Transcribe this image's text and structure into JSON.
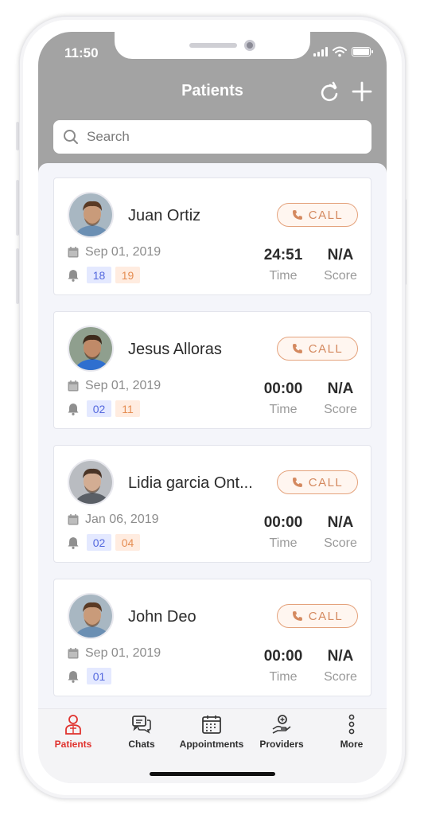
{
  "status_bar": {
    "time": "11:50"
  },
  "header": {
    "title": "Patients"
  },
  "search": {
    "placeholder": "Search"
  },
  "patients": [
    {
      "name": "Juan Ortiz",
      "date": "Sep 01, 2019",
      "badges": [
        "18",
        "19"
      ],
      "time": "24:51",
      "time_label": "Time",
      "score": "N/A",
      "score_label": "Score",
      "call_label": "CALL"
    },
    {
      "name": "Jesus Alloras",
      "date": "Sep 01, 2019",
      "badges": [
        "02",
        "11"
      ],
      "time": "00:00",
      "time_label": "Time",
      "score": "N/A",
      "score_label": "Score",
      "call_label": "CALL"
    },
    {
      "name": "Lidia garcia Ont...",
      "date": "Jan 06, 2019",
      "badges": [
        "02",
        "04"
      ],
      "time": "00:00",
      "time_label": "Time",
      "score": "N/A",
      "score_label": "Score",
      "call_label": "CALL"
    },
    {
      "name": "John Deo",
      "date": "Sep 01, 2019",
      "badges": [
        "01"
      ],
      "time": "00:00",
      "time_label": "Time",
      "score": "N/A",
      "score_label": "Score",
      "call_label": "CALL"
    }
  ],
  "tabs": [
    {
      "label": "Patients",
      "icon": "patient-icon",
      "active": true
    },
    {
      "label": "Chats",
      "icon": "chat-icon",
      "active": false
    },
    {
      "label": "Appointments",
      "icon": "calendar-icon",
      "active": false
    },
    {
      "label": "Providers",
      "icon": "provider-icon",
      "active": false
    },
    {
      "label": "More",
      "icon": "more-icon",
      "active": false
    }
  ],
  "colors": {
    "header_bg": "#a3a3a3",
    "accent_active": "#e0322e",
    "call_orange": "#d4895f",
    "badge_blue": "#5468de",
    "badge_orange": "#e58d52"
  }
}
